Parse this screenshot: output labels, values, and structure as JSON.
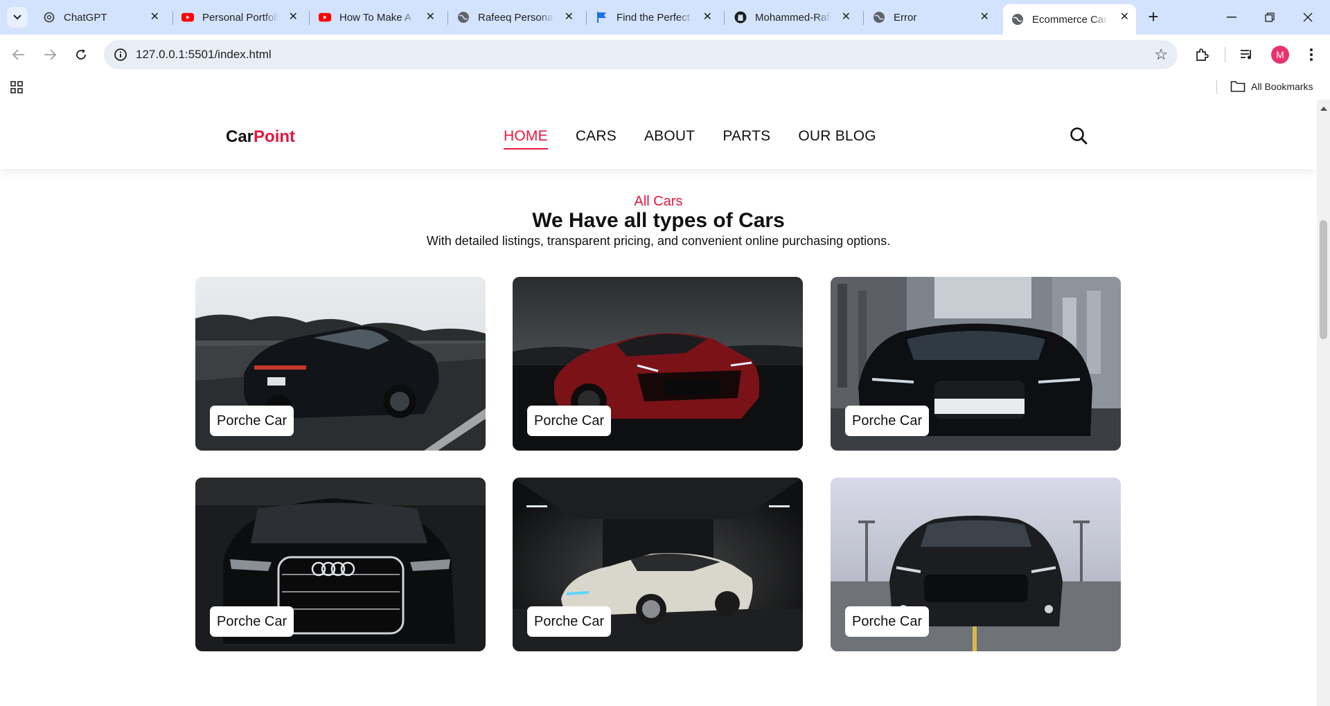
{
  "browser": {
    "tabs": [
      {
        "title": "ChatGPT",
        "icon": "chatgpt-icon"
      },
      {
        "title": "Personal Portfolio",
        "icon": "youtube-icon"
      },
      {
        "title": "How To Make A",
        "icon": "youtube-icon"
      },
      {
        "title": "Rafeeq Personal",
        "icon": "globe-icon"
      },
      {
        "title": "Find the Perfect",
        "icon": "flag-icon"
      },
      {
        "title": "Mohammed-Rafeeq",
        "icon": "github-icon"
      },
      {
        "title": "Error",
        "icon": "globe-icon"
      },
      {
        "title": "Ecommerce Car",
        "icon": "globe-icon",
        "active": true
      }
    ],
    "url": "127.0.0.1:5501/index.html",
    "avatar_letter": "M",
    "bookmarks_label": "All Bookmarks"
  },
  "site": {
    "logo_part1": "Car",
    "logo_part2": "Point",
    "nav": [
      {
        "label": "HOME",
        "active": true
      },
      {
        "label": "CARS"
      },
      {
        "label": "ABOUT"
      },
      {
        "label": "PARTS"
      },
      {
        "label": "OUR BLOG"
      }
    ]
  },
  "section": {
    "eyebrow": "All Cars",
    "title": "We Have all types of Cars",
    "subtitle": "With detailed listings, transparent pricing, and convenient online purchasing options."
  },
  "cars": [
    {
      "label": "Porche Car",
      "scene": "dark-sedan-on-road"
    },
    {
      "label": "Porche Car",
      "scene": "red-sports-car-at-dusk"
    },
    {
      "label": "Porche Car",
      "scene": "black-audi-city-street"
    },
    {
      "label": "Porche Car",
      "scene": "black-audi-front-grille"
    },
    {
      "label": "Porche Car",
      "scene": "white-audi-in-garage"
    },
    {
      "label": "Porche Car",
      "scene": "black-mustang-parking-deck"
    }
  ],
  "colors": {
    "accent": "#e5163f",
    "tabbar": "#d3e3fd",
    "omnibox": "#e9eef6"
  }
}
